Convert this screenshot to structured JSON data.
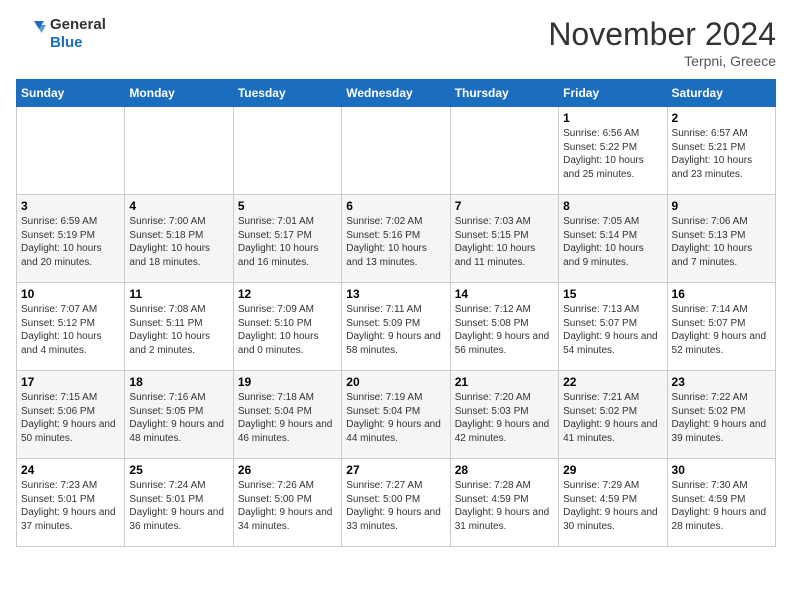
{
  "logo": {
    "line1": "General",
    "line2": "Blue"
  },
  "header": {
    "month": "November 2024",
    "location": "Terpni, Greece"
  },
  "weekdays": [
    "Sunday",
    "Monday",
    "Tuesday",
    "Wednesday",
    "Thursday",
    "Friday",
    "Saturday"
  ],
  "weeks": [
    [
      {
        "day": "",
        "info": ""
      },
      {
        "day": "",
        "info": ""
      },
      {
        "day": "",
        "info": ""
      },
      {
        "day": "",
        "info": ""
      },
      {
        "day": "",
        "info": ""
      },
      {
        "day": "1",
        "info": "Sunrise: 6:56 AM\nSunset: 5:22 PM\nDaylight: 10 hours and 25 minutes."
      },
      {
        "day": "2",
        "info": "Sunrise: 6:57 AM\nSunset: 5:21 PM\nDaylight: 10 hours and 23 minutes."
      }
    ],
    [
      {
        "day": "3",
        "info": "Sunrise: 6:59 AM\nSunset: 5:19 PM\nDaylight: 10 hours and 20 minutes."
      },
      {
        "day": "4",
        "info": "Sunrise: 7:00 AM\nSunset: 5:18 PM\nDaylight: 10 hours and 18 minutes."
      },
      {
        "day": "5",
        "info": "Sunrise: 7:01 AM\nSunset: 5:17 PM\nDaylight: 10 hours and 16 minutes."
      },
      {
        "day": "6",
        "info": "Sunrise: 7:02 AM\nSunset: 5:16 PM\nDaylight: 10 hours and 13 minutes."
      },
      {
        "day": "7",
        "info": "Sunrise: 7:03 AM\nSunset: 5:15 PM\nDaylight: 10 hours and 11 minutes."
      },
      {
        "day": "8",
        "info": "Sunrise: 7:05 AM\nSunset: 5:14 PM\nDaylight: 10 hours and 9 minutes."
      },
      {
        "day": "9",
        "info": "Sunrise: 7:06 AM\nSunset: 5:13 PM\nDaylight: 10 hours and 7 minutes."
      }
    ],
    [
      {
        "day": "10",
        "info": "Sunrise: 7:07 AM\nSunset: 5:12 PM\nDaylight: 10 hours and 4 minutes."
      },
      {
        "day": "11",
        "info": "Sunrise: 7:08 AM\nSunset: 5:11 PM\nDaylight: 10 hours and 2 minutes."
      },
      {
        "day": "12",
        "info": "Sunrise: 7:09 AM\nSunset: 5:10 PM\nDaylight: 10 hours and 0 minutes."
      },
      {
        "day": "13",
        "info": "Sunrise: 7:11 AM\nSunset: 5:09 PM\nDaylight: 9 hours and 58 minutes."
      },
      {
        "day": "14",
        "info": "Sunrise: 7:12 AM\nSunset: 5:08 PM\nDaylight: 9 hours and 56 minutes."
      },
      {
        "day": "15",
        "info": "Sunrise: 7:13 AM\nSunset: 5:07 PM\nDaylight: 9 hours and 54 minutes."
      },
      {
        "day": "16",
        "info": "Sunrise: 7:14 AM\nSunset: 5:07 PM\nDaylight: 9 hours and 52 minutes."
      }
    ],
    [
      {
        "day": "17",
        "info": "Sunrise: 7:15 AM\nSunset: 5:06 PM\nDaylight: 9 hours and 50 minutes."
      },
      {
        "day": "18",
        "info": "Sunrise: 7:16 AM\nSunset: 5:05 PM\nDaylight: 9 hours and 48 minutes."
      },
      {
        "day": "19",
        "info": "Sunrise: 7:18 AM\nSunset: 5:04 PM\nDaylight: 9 hours and 46 minutes."
      },
      {
        "day": "20",
        "info": "Sunrise: 7:19 AM\nSunset: 5:04 PM\nDaylight: 9 hours and 44 minutes."
      },
      {
        "day": "21",
        "info": "Sunrise: 7:20 AM\nSunset: 5:03 PM\nDaylight: 9 hours and 42 minutes."
      },
      {
        "day": "22",
        "info": "Sunrise: 7:21 AM\nSunset: 5:02 PM\nDaylight: 9 hours and 41 minutes."
      },
      {
        "day": "23",
        "info": "Sunrise: 7:22 AM\nSunset: 5:02 PM\nDaylight: 9 hours and 39 minutes."
      }
    ],
    [
      {
        "day": "24",
        "info": "Sunrise: 7:23 AM\nSunset: 5:01 PM\nDaylight: 9 hours and 37 minutes."
      },
      {
        "day": "25",
        "info": "Sunrise: 7:24 AM\nSunset: 5:01 PM\nDaylight: 9 hours and 36 minutes."
      },
      {
        "day": "26",
        "info": "Sunrise: 7:26 AM\nSunset: 5:00 PM\nDaylight: 9 hours and 34 minutes."
      },
      {
        "day": "27",
        "info": "Sunrise: 7:27 AM\nSunset: 5:00 PM\nDaylight: 9 hours and 33 minutes."
      },
      {
        "day": "28",
        "info": "Sunrise: 7:28 AM\nSunset: 4:59 PM\nDaylight: 9 hours and 31 minutes."
      },
      {
        "day": "29",
        "info": "Sunrise: 7:29 AM\nSunset: 4:59 PM\nDaylight: 9 hours and 30 minutes."
      },
      {
        "day": "30",
        "info": "Sunrise: 7:30 AM\nSunset: 4:59 PM\nDaylight: 9 hours and 28 minutes."
      }
    ]
  ]
}
